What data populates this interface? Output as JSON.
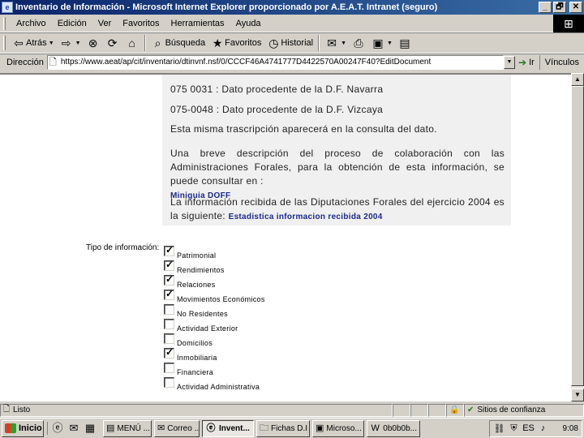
{
  "window": {
    "title": "Inventario de Información - Microsoft Internet Explorer proporcionado por A.E.A.T. Intranet (seguro)",
    "buttons": {
      "minimize": "_",
      "maximize": "🗗",
      "close": "✕"
    }
  },
  "menu": {
    "items": [
      "Archivo",
      "Edición",
      "Ver",
      "Favoritos",
      "Herramientas",
      "Ayuda"
    ]
  },
  "toolbar": {
    "back": "Atrás",
    "search": "Búsqueda",
    "favorites": "Favoritos",
    "history": "Historial"
  },
  "address": {
    "label": "Dirección",
    "url": "https://www.aeat/ap/cit/inventario/dtinvnf.nsf/0/CCCF46A4741777D4422570A00247F40?EditDocument",
    "go": "Ir",
    "links": "Vínculos"
  },
  "content": {
    "paragraphs": {
      "navarra": "075 0031 : Dato procedente de la D.F. Navarra",
      "vizcaya": "075-0048 : Dato procedente de la D.F. Vizcaya",
      "transcripcion": "Esta misma trascripción aparecerá en la consulta del dato.",
      "descripcion": "Una breve descripción del proceso de colaboración con las Administraciones Forales, para la obtención de esta información, se puede consultar en :",
      "recibida": "La información recibida de las Diputaciones Forales del ejercicio 2004 es la siguiente:"
    },
    "links": {
      "miniguia": "Miniguia DOFF",
      "estadistica": "Estadistica informacion recibida 2004"
    },
    "tipo_label": "Tipo de información:",
    "options": [
      {
        "label": "Patrimonial",
        "checked": true
      },
      {
        "label": "Rendimientos",
        "checked": true
      },
      {
        "label": "Relaciones",
        "checked": true
      },
      {
        "label": "Movimientos Económicos",
        "checked": true
      },
      {
        "label": "No Residentes",
        "checked": false
      },
      {
        "label": "Actividad Exterior",
        "checked": false
      },
      {
        "label": "Domicilios",
        "checked": false
      },
      {
        "label": "Inmobiliaria",
        "checked": true
      },
      {
        "label": "Financiera",
        "checked": false
      },
      {
        "label": "Actividad Administrativa",
        "checked": false
      }
    ]
  },
  "status": {
    "text": "Listo",
    "zone": "Sitios de confianza"
  },
  "taskbar": {
    "start": "Inicio",
    "tasks": [
      {
        "label": "MENÚ ...",
        "active": false
      },
      {
        "label": "Correo ...",
        "active": false
      },
      {
        "label": "Invent...",
        "active": true
      },
      {
        "label": "Fichas D.I",
        "active": false
      },
      {
        "label": "Microso...",
        "active": false
      },
      {
        "label": "0b0b0b...",
        "active": false
      }
    ],
    "clock": "9:08"
  }
}
